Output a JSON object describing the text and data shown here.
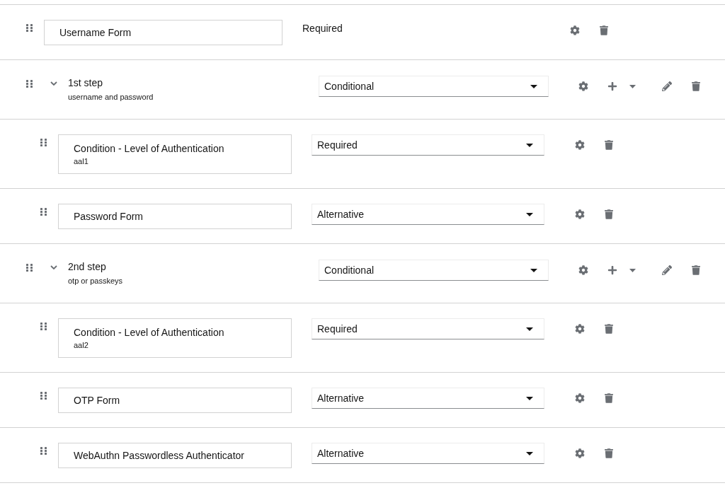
{
  "executions": [
    {
      "kind": "execution",
      "name": "Username Form",
      "requirement": {
        "kind": "label",
        "value": "Required"
      }
    },
    {
      "kind": "flow",
      "name": "1st step",
      "description": "username and password",
      "expanded": true,
      "requirement": {
        "kind": "select",
        "value": "Conditional"
      },
      "children": [
        {
          "kind": "execution",
          "name": "Condition - Level of Authentication",
          "description": "aal1",
          "requirement": {
            "kind": "select",
            "value": "Required"
          }
        },
        {
          "kind": "execution",
          "name": "Password Form",
          "requirement": {
            "kind": "select",
            "value": "Alternative"
          }
        }
      ]
    },
    {
      "kind": "flow",
      "name": "2nd step",
      "description": "otp or passkeys",
      "expanded": true,
      "requirement": {
        "kind": "select",
        "value": "Conditional"
      },
      "children": [
        {
          "kind": "execution",
          "name": "Condition - Level of Authentication",
          "description": "aal2",
          "requirement": {
            "kind": "select",
            "value": "Required"
          }
        },
        {
          "kind": "execution",
          "name": "OTP Form",
          "requirement": {
            "kind": "select",
            "value": "Alternative"
          }
        },
        {
          "kind": "execution",
          "name": "WebAuthn Passwordless Authenticator",
          "requirement": {
            "kind": "select",
            "value": "Alternative"
          }
        }
      ]
    }
  ]
}
